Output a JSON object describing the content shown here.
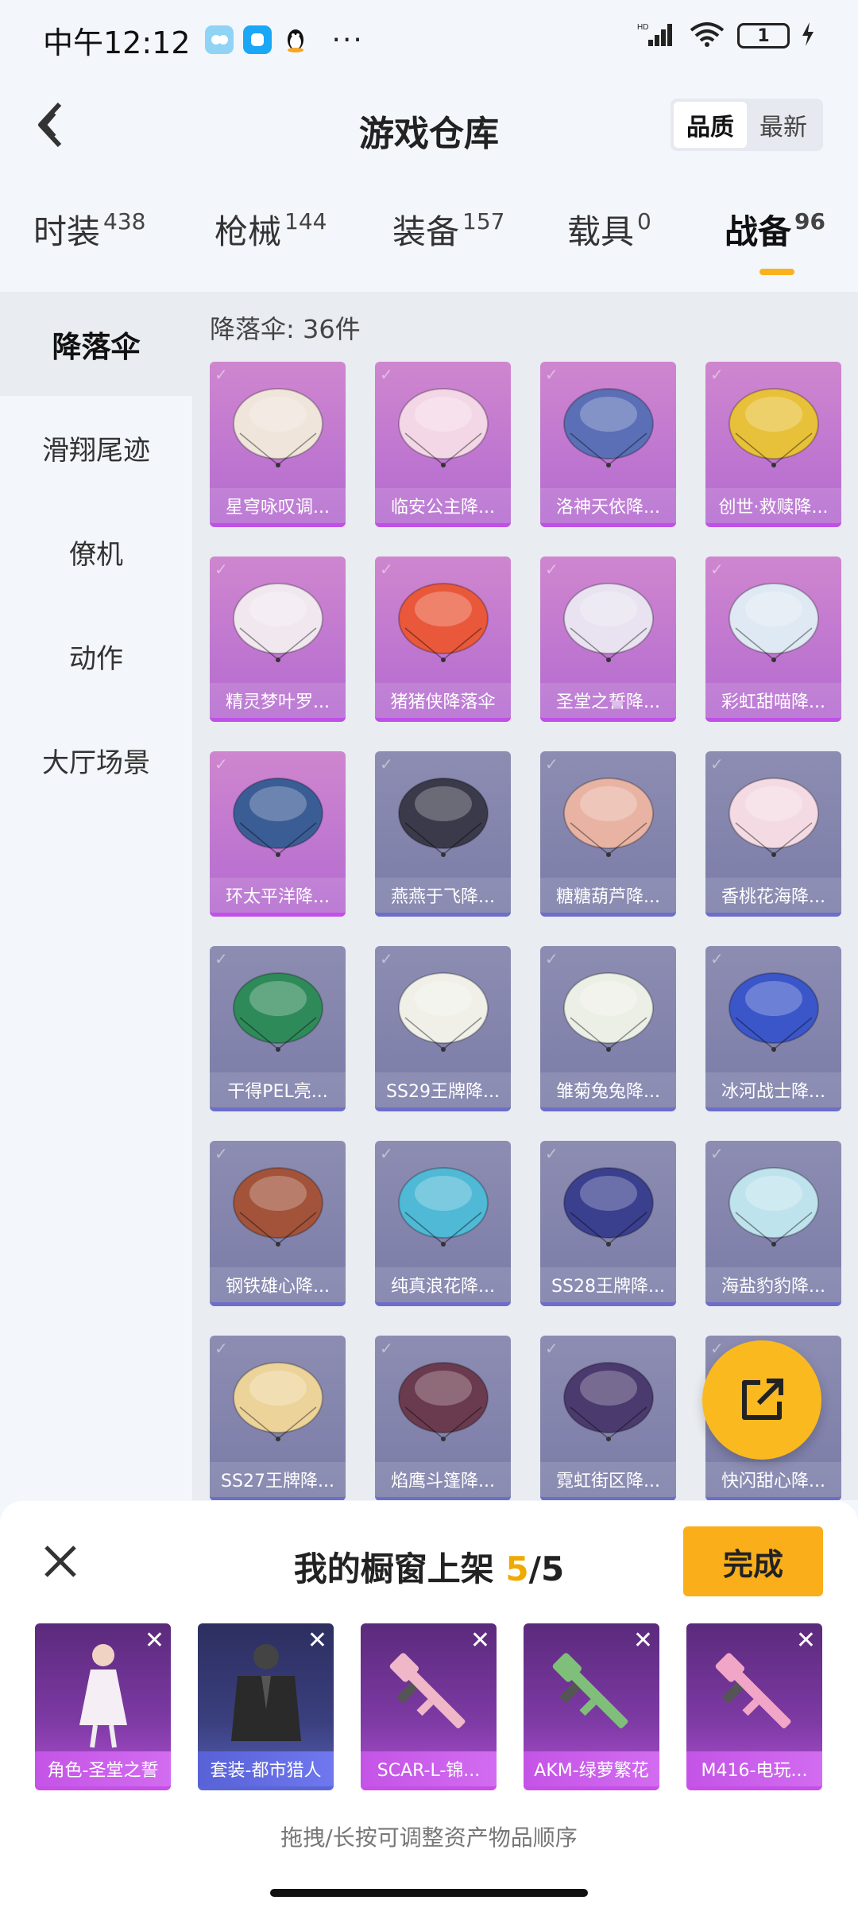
{
  "status_bar": {
    "time": "中午12:12",
    "more": "···",
    "network": "HD",
    "battery": "1"
  },
  "header": {
    "title": "游戏仓库",
    "sort_options": [
      "品质",
      "最新"
    ],
    "sort_selected": "品质"
  },
  "categories": [
    {
      "label": "时装",
      "count": "438"
    },
    {
      "label": "枪械",
      "count": "144"
    },
    {
      "label": "装备",
      "count": "157"
    },
    {
      "label": "载具",
      "count": "0"
    },
    {
      "label": "战备",
      "count": "96",
      "active": true
    }
  ],
  "sidebar": {
    "items": [
      {
        "label": "降落伞",
        "active": true
      },
      {
        "label": "滑翔尾迹"
      },
      {
        "label": "僚机"
      },
      {
        "label": "动作"
      },
      {
        "label": "大厅场景"
      }
    ]
  },
  "section": {
    "title": "降落伞: 36件"
  },
  "items": [
    {
      "name": "星穹咏叹调...",
      "tier": "purple",
      "color": "#efe5da"
    },
    {
      "name": "临安公主降...",
      "tier": "purple",
      "color": "#f3d7e6"
    },
    {
      "name": "洛神天依降...",
      "tier": "purple",
      "color": "#5a6fb6"
    },
    {
      "name": "创世·救赎降...",
      "tier": "purple",
      "color": "#e8c13a"
    },
    {
      "name": "精灵梦叶罗...",
      "tier": "purple",
      "color": "#f1e7ef"
    },
    {
      "name": "猪猪侠降落伞",
      "tier": "purple",
      "color": "#e9583a"
    },
    {
      "name": "圣堂之誓降...",
      "tier": "purple",
      "color": "#e9e3f1"
    },
    {
      "name": "彩虹甜喵降...",
      "tier": "purple",
      "color": "#dfe9f3"
    },
    {
      "name": "环太平洋降...",
      "tier": "purple",
      "color": "#3b5d96"
    },
    {
      "name": "燕燕于飞降...",
      "tier": "gray",
      "color": "#3a3a4a"
    },
    {
      "name": "糖糖葫芦降...",
      "tier": "gray",
      "color": "#e9b3a3"
    },
    {
      "name": "香桃花海降...",
      "tier": "gray",
      "color": "#f4dbe3"
    },
    {
      "name": "干得PEL亮...",
      "tier": "gray",
      "color": "#2f8a5a"
    },
    {
      "name": "SS29王牌降...",
      "tier": "gray",
      "color": "#f0f0e8"
    },
    {
      "name": "雏菊兔兔降...",
      "tier": "gray",
      "color": "#ecefe6"
    },
    {
      "name": "冰河战士降...",
      "tier": "gray",
      "color": "#3b56c8"
    },
    {
      "name": "钢铁雄心降...",
      "tier": "gray",
      "color": "#a2533a"
    },
    {
      "name": "纯真浪花降...",
      "tier": "gray",
      "color": "#4fb9d6"
    },
    {
      "name": "SS28王牌降...",
      "tier": "gray",
      "color": "#3a3f8e"
    },
    {
      "name": "海盐豹豹降...",
      "tier": "gray",
      "color": "#bfe3ec"
    },
    {
      "name": "SS27王牌降...",
      "tier": "gray",
      "color": "#ecd39a"
    },
    {
      "name": "焰鹰斗篷降...",
      "tier": "gray",
      "color": "#6a3a4e"
    },
    {
      "name": "霓虹街区降...",
      "tier": "gray",
      "color": "#4a3a6e"
    },
    {
      "name": "快闪甜心降...",
      "tier": "gray",
      "color": "#c9b3d8"
    }
  ],
  "showcase": {
    "title": "我的橱窗上架",
    "count": "5",
    "sep": "/",
    "total": "5",
    "done_label": "完成",
    "slots": [
      {
        "name": "角色-圣堂之誓",
        "tier": "purple"
      },
      {
        "name": "套装-都市猎人",
        "tier": "navy"
      },
      {
        "name": "SCAR-L-锦...",
        "tier": "purple"
      },
      {
        "name": "AKM-绿萝繁花",
        "tier": "purple"
      },
      {
        "name": "M416-电玩...",
        "tier": "purple"
      }
    ],
    "hint": "拖拽/长按可调整资产物品顺序"
  }
}
